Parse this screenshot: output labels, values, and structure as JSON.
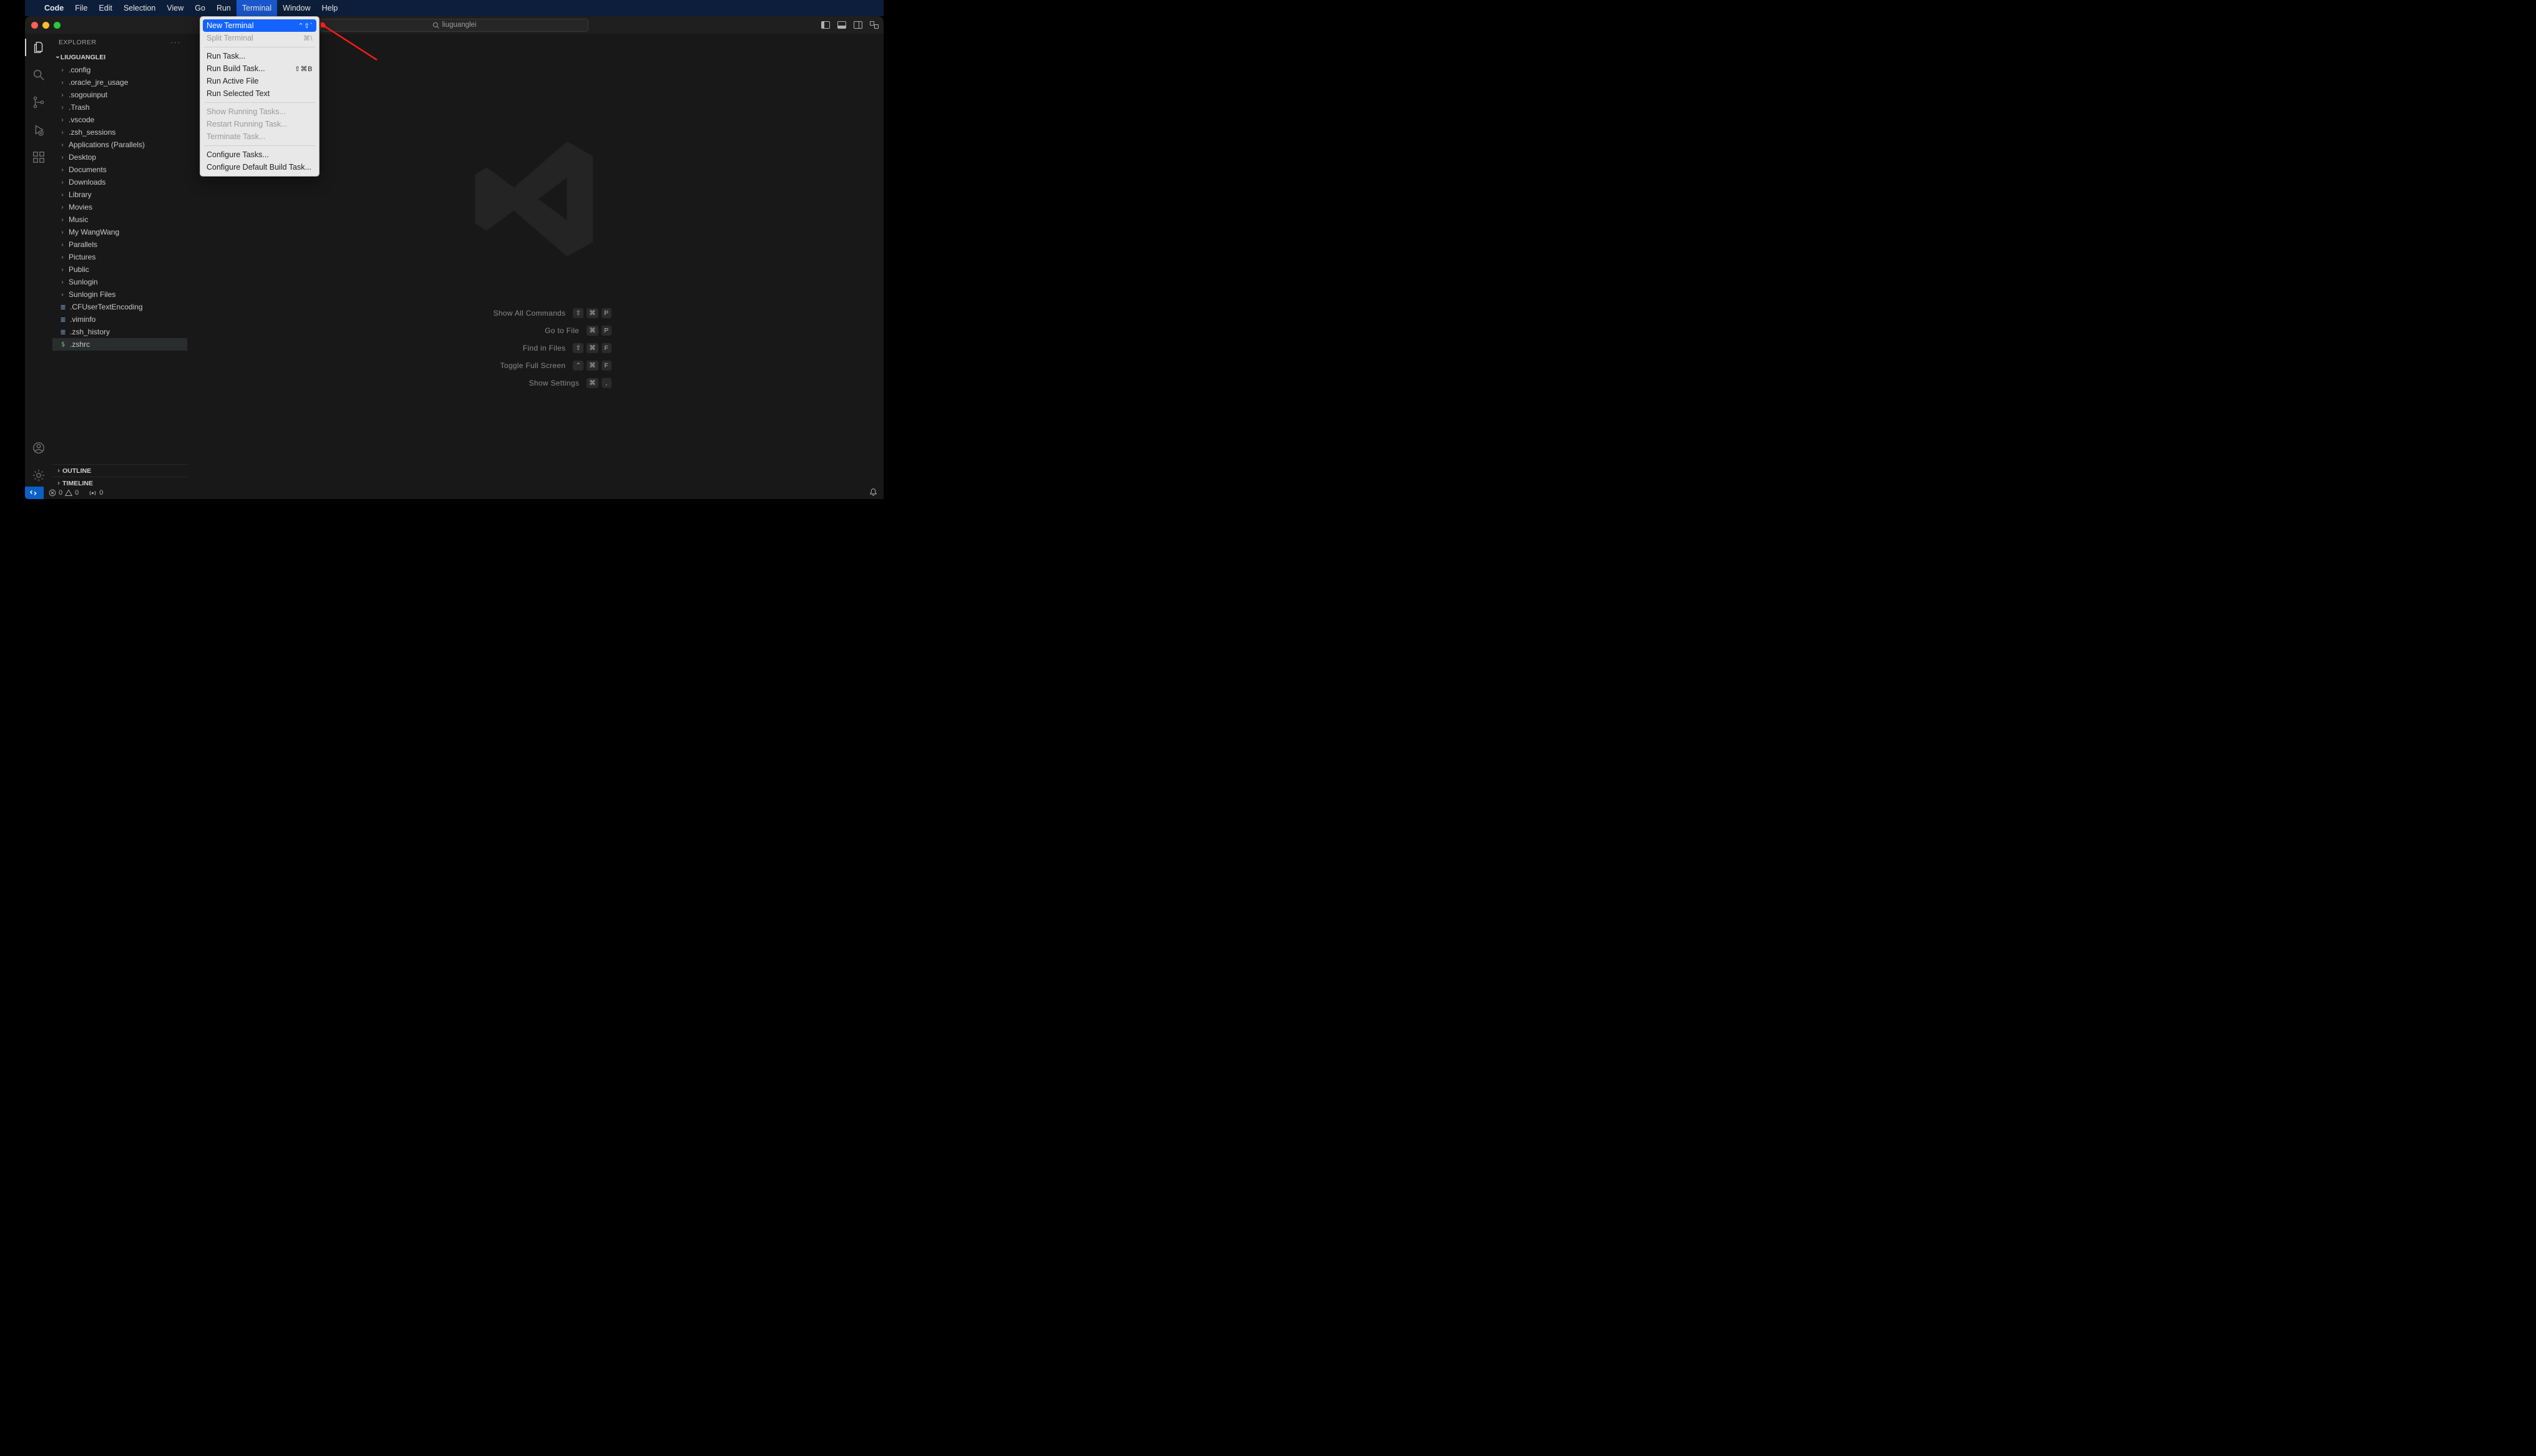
{
  "macMenu": {
    "appName": "Code",
    "items": [
      "File",
      "Edit",
      "Selection",
      "View",
      "Go",
      "Run",
      "Terminal",
      "Window",
      "Help"
    ],
    "activeIndex": 6
  },
  "titlebar": {
    "searchText": "liuguanglei"
  },
  "activitybar": {
    "items": [
      {
        "name": "explorer-icon",
        "active": true
      },
      {
        "name": "search-icon",
        "active": false
      },
      {
        "name": "source-control-icon",
        "active": false
      },
      {
        "name": "run-debug-icon",
        "active": false
      },
      {
        "name": "extensions-icon",
        "active": false
      }
    ],
    "bottomItems": [
      {
        "name": "accounts-icon"
      },
      {
        "name": "manage-icon"
      }
    ]
  },
  "sidebar": {
    "title": "EXPLORER",
    "folderName": "LIUGUANGLEI",
    "tree": [
      {
        "type": "folder",
        "label": ".config"
      },
      {
        "type": "folder",
        "label": ".oracle_jre_usage"
      },
      {
        "type": "folder",
        "label": ".sogouinput"
      },
      {
        "type": "folder",
        "label": ".Trash"
      },
      {
        "type": "folder",
        "label": ".vscode"
      },
      {
        "type": "folder",
        "label": ".zsh_sessions"
      },
      {
        "type": "folder",
        "label": "Applications (Parallels)"
      },
      {
        "type": "folder",
        "label": "Desktop"
      },
      {
        "type": "folder",
        "label": "Documents"
      },
      {
        "type": "folder",
        "label": "Downloads"
      },
      {
        "type": "folder",
        "label": "Library"
      },
      {
        "type": "folder",
        "label": "Movies"
      },
      {
        "type": "folder",
        "label": "Music"
      },
      {
        "type": "folder",
        "label": "My WangWang"
      },
      {
        "type": "folder",
        "label": "Parallels"
      },
      {
        "type": "folder",
        "label": "Pictures"
      },
      {
        "type": "folder",
        "label": "Public"
      },
      {
        "type": "folder",
        "label": "Sunlogin"
      },
      {
        "type": "folder",
        "label": "Sunlogin Files"
      },
      {
        "type": "file",
        "label": ".CFUserTextEncoding",
        "icon": "txt"
      },
      {
        "type": "file",
        "label": ".viminfo",
        "icon": "txt"
      },
      {
        "type": "file",
        "label": ".zsh_history",
        "icon": "txt"
      },
      {
        "type": "file",
        "label": ".zshrc",
        "icon": "dollar",
        "selected": true
      }
    ],
    "sections": [
      {
        "label": "OUTLINE"
      },
      {
        "label": "TIMELINE"
      }
    ]
  },
  "shortcuts": [
    {
      "label": "Show All Commands",
      "keys": [
        "⇧",
        "⌘",
        "P"
      ]
    },
    {
      "label": "Go to File",
      "keys": [
        "⌘",
        "P"
      ]
    },
    {
      "label": "Find in Files",
      "keys": [
        "⇧",
        "⌘",
        "F"
      ]
    },
    {
      "label": "Toggle Full Screen",
      "keys": [
        "⌃",
        "⌘",
        "F"
      ]
    },
    {
      "label": "Show Settings",
      "keys": [
        "⌘",
        ","
      ]
    }
  ],
  "statusbar": {
    "errors": "0",
    "warnings": "0",
    "ports": "0"
  },
  "terminalMenu": {
    "groups": [
      [
        {
          "label": "New Terminal",
          "shortcut": "⌃⇧`",
          "highlighted": true
        },
        {
          "label": "Split Terminal",
          "shortcut": "⌘\\",
          "disabled": true
        }
      ],
      [
        {
          "label": "Run Task..."
        },
        {
          "label": "Run Build Task...",
          "shortcut": "⇧⌘B"
        },
        {
          "label": "Run Active File"
        },
        {
          "label": "Run Selected Text"
        }
      ],
      [
        {
          "label": "Show Running Tasks...",
          "disabled": true
        },
        {
          "label": "Restart Running Task...",
          "disabled": true
        },
        {
          "label": "Terminate Task...",
          "disabled": true
        }
      ],
      [
        {
          "label": "Configure Tasks..."
        },
        {
          "label": "Configure Default Build Task..."
        }
      ]
    ]
  }
}
